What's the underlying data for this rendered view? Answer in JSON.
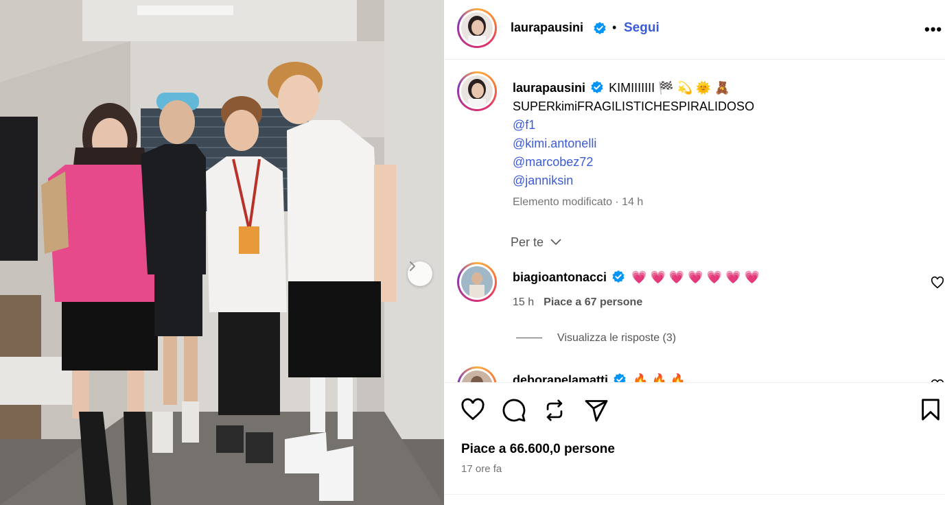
{
  "post": {
    "author": "laurapausini",
    "follow_label": "Segui",
    "separator": "•",
    "more_label": "•••"
  },
  "caption": {
    "author": "laurapausini",
    "line1": "KIMIIIIIII 🏁 💫 🌞 🧸",
    "line2": "SUPERkimiFRAGILISTICHESPIRALIDOSO",
    "mentions": [
      "@f1",
      "@kimi.antonelli",
      "@marcobez72",
      "@janniksin"
    ],
    "meta": "Elemento modificato · 14 h"
  },
  "filter": {
    "label": "Per te"
  },
  "comments": [
    {
      "author": "biagioantonacci",
      "text": "💗 💗 💗 💗 💗 💗 💗",
      "time": "15 h",
      "likes": "Piace a 67 persone",
      "replies": "Visualizza le risposte (3)"
    },
    {
      "author": "deborapelamatti",
      "text": "🔥 🔥 🔥"
    }
  ],
  "footer": {
    "likes": "Piace a 66.600,0 persone",
    "time": "17 ore fa"
  },
  "icons": {
    "verified": "verified-badge-icon",
    "like": "heart-icon",
    "comment": "comment-bubble-icon",
    "share": "repost-icon",
    "send": "paper-plane-icon",
    "save": "bookmark-icon",
    "next": "chevron-right-icon"
  },
  "colors": {
    "link": "#3a5bd9",
    "verified": "#0095f6",
    "muted": "#737373"
  }
}
